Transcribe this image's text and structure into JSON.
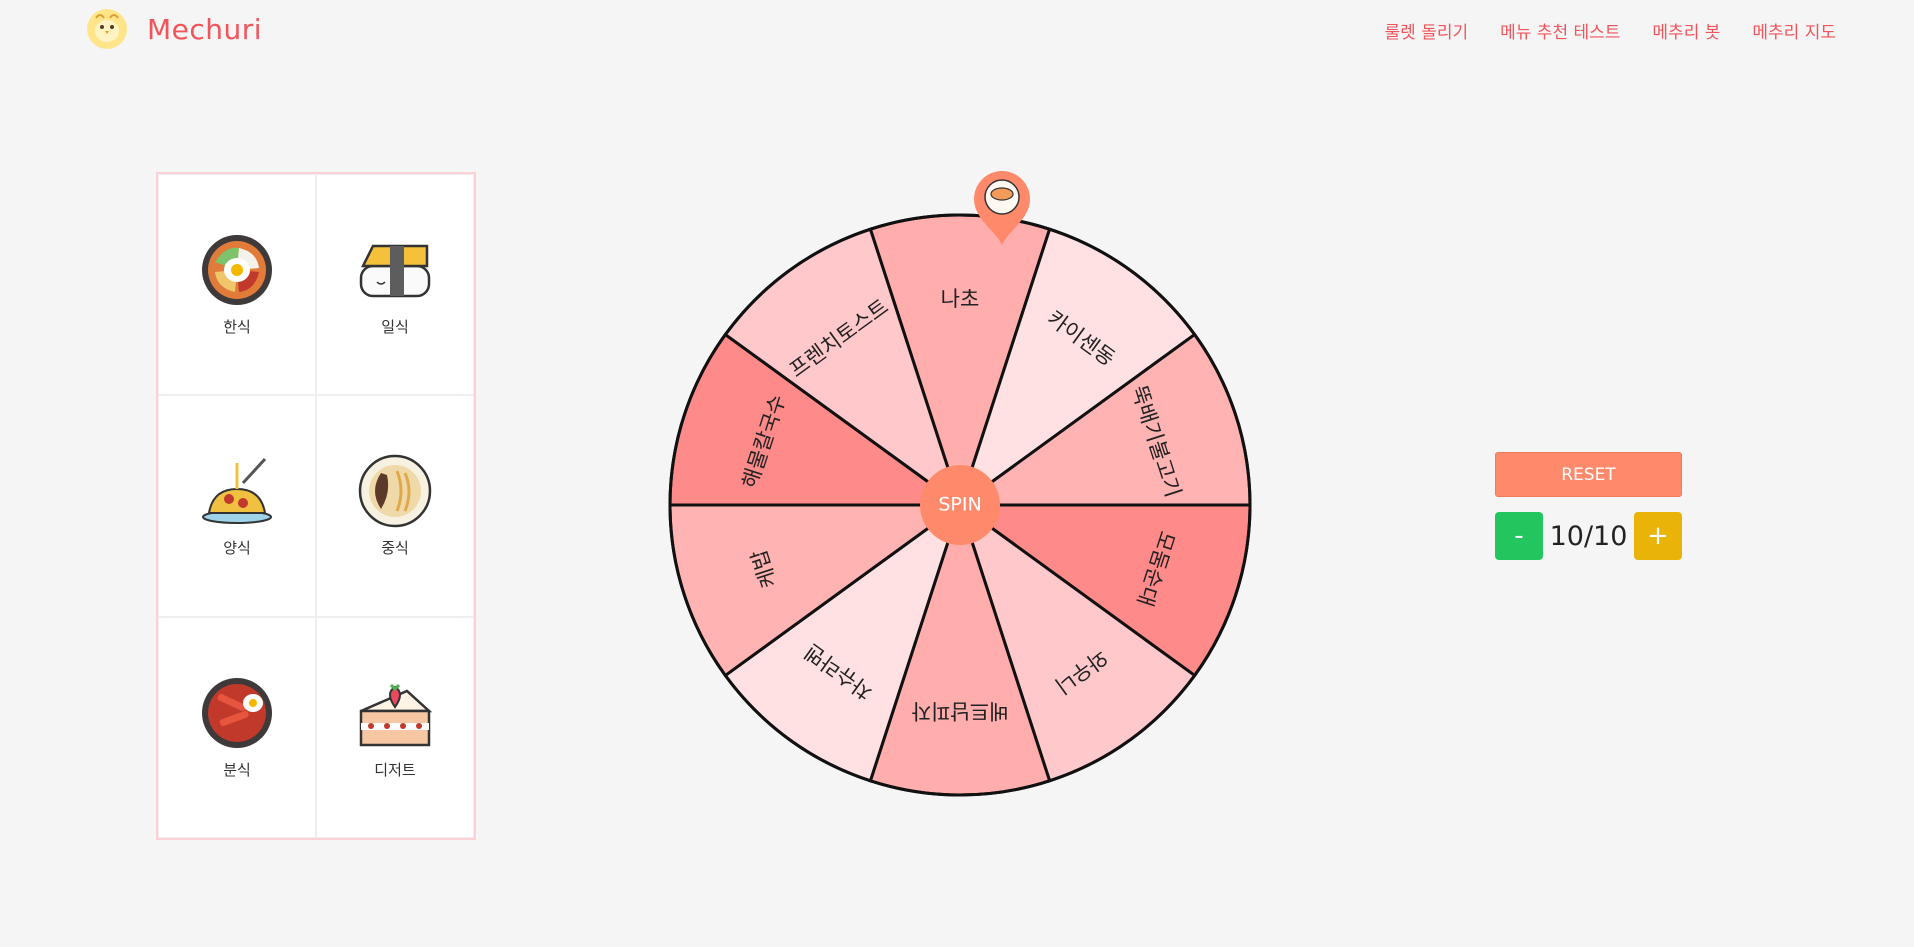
{
  "header": {
    "brand": "Mechuri",
    "nav": [
      "룰렛 돌리기",
      "메뉴 추천 테스트",
      "메추리 봇",
      "메추리 지도"
    ]
  },
  "categories": [
    {
      "label": "한식",
      "icon": "bibimbap-icon"
    },
    {
      "label": "일식",
      "icon": "sushi-icon"
    },
    {
      "label": "양식",
      "icon": "spaghetti-icon"
    },
    {
      "label": "중식",
      "icon": "jajangmyeon-icon"
    },
    {
      "label": "분식",
      "icon": "tteokbokki-icon"
    },
    {
      "label": "디저트",
      "icon": "cake-icon"
    }
  ],
  "wheel": {
    "segments": [
      {
        "label": "나초",
        "color": "#ffadad"
      },
      {
        "label": "카이센동",
        "color": "#ffe1e3"
      },
      {
        "label": "뚝배기불고기",
        "color": "#ffb3b3"
      },
      {
        "label": "모둠순대",
        "color": "#ff8a8a"
      },
      {
        "label": "와우니",
        "color": "#ffc8ca"
      },
      {
        "label": "베트남피자",
        "color": "#ffadad"
      },
      {
        "label": "차슈라멘",
        "color": "#ffe1e3"
      },
      {
        "label": "케밥",
        "color": "#ffb3b3"
      },
      {
        "label": "해물칼국수",
        "color": "#ff8a8a"
      },
      {
        "label": "프렌치토스트",
        "color": "#ffc8ca"
      }
    ],
    "spin_label": "SPIN",
    "hub_color": "#ff8a6b",
    "pin_color": "#ff8a6b"
  },
  "controls": {
    "reset_label": "RESET",
    "minus_label": "-",
    "plus_label": "+",
    "count": "10/10"
  },
  "colors": {
    "brand": "#f2545b",
    "accent": "#ff8a6b",
    "minus": "#22c55e",
    "plus": "#eab308"
  }
}
